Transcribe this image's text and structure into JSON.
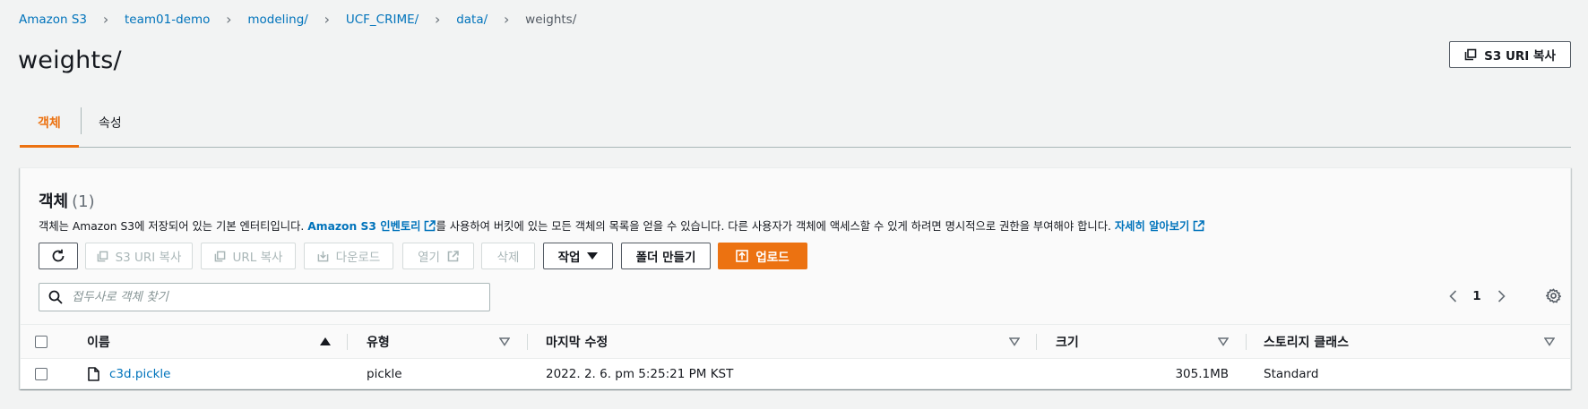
{
  "breadcrumb": [
    {
      "label": "Amazon S3",
      "current": false
    },
    {
      "label": "team01-demo",
      "current": false
    },
    {
      "label": "modeling/",
      "current": false
    },
    {
      "label": "UCF_CRIME/",
      "current": false
    },
    {
      "label": "data/",
      "current": false
    },
    {
      "label": "weights/",
      "current": true
    }
  ],
  "page": {
    "title": "weights/",
    "copy_uri_label": "S3 URI 복사"
  },
  "tabs": [
    {
      "label": "객체",
      "active": true
    },
    {
      "label": "속성",
      "active": false
    }
  ],
  "objects": {
    "title": "객체",
    "count": "(1)",
    "desc_part1": "객체는 Amazon S3에 저장되어 있는 기본 엔터티입니다. ",
    "desc_link1": "Amazon S3 인벤토리",
    "desc_part2": "를 사용하여 버킷에 있는 모든 객체의 목록을 얻을 수 있습니다. 다른 사용자가 객체에 액세스할 수 있게 하려면 명시적으로 권한을 부여해야 합니다. ",
    "desc_link2": "자세히 알아보기"
  },
  "actions": {
    "copy_s3_uri": "S3 URI 복사",
    "copy_url": "URL 복사",
    "download": "다운로드",
    "open": "열기",
    "delete": "삭제",
    "actions_menu": "작업",
    "create_folder": "폴더 만들기",
    "upload": "업로드"
  },
  "search": {
    "placeholder": "접두사로 객체 찾기",
    "value": ""
  },
  "pagination": {
    "current_page": "1"
  },
  "table": {
    "columns": [
      "이름",
      "유형",
      "마지막 수정",
      "크기",
      "스토리지 클래스"
    ],
    "rows": [
      {
        "name": "c3d.pickle",
        "type": "pickle",
        "last_modified": "2022. 2. 6. pm 5:25:21 PM KST",
        "size": "305.1MB",
        "storage_class": "Standard"
      }
    ]
  },
  "colors": {
    "accent": "#ec7211",
    "link": "#0073bb",
    "text": "#16191f",
    "background": "#f2f3f3"
  }
}
